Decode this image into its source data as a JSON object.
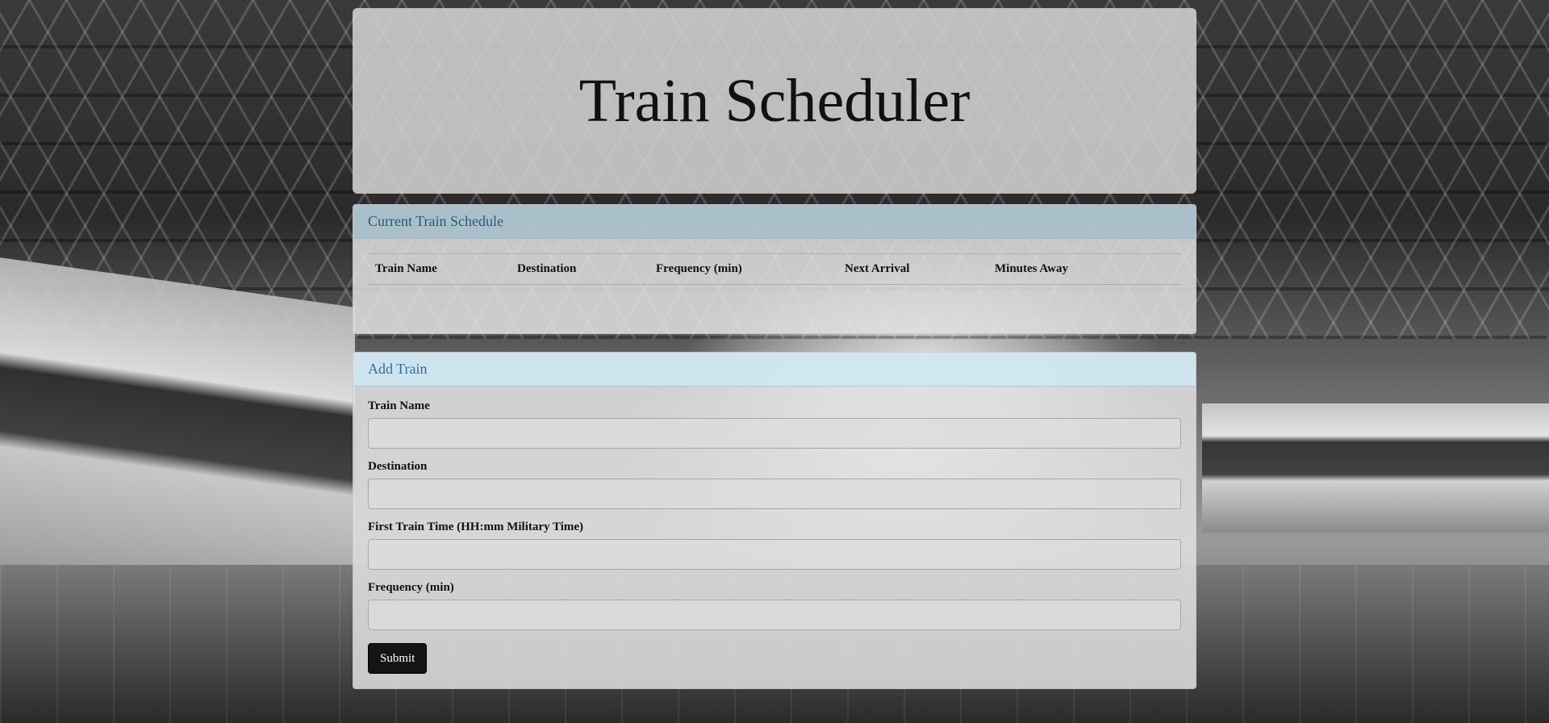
{
  "header": {
    "title": "Train Scheduler"
  },
  "schedule": {
    "heading": "Current Train Schedule",
    "columns": [
      "Train Name",
      "Destination",
      "Frequency (min)",
      "Next Arrival",
      "Minutes Away"
    ],
    "rows": []
  },
  "add_train": {
    "heading": "Add Train",
    "fields": [
      {
        "label": "Train Name",
        "value": "",
        "placeholder": ""
      },
      {
        "label": "Destination",
        "value": "",
        "placeholder": ""
      },
      {
        "label": "First Train Time (HH:mm Military Time)",
        "value": "",
        "placeholder": ""
      },
      {
        "label": "Frequency (min)",
        "value": "",
        "placeholder": ""
      }
    ],
    "submit_label": "Submit"
  },
  "colors": {
    "primary_heading_bg": "#a2becc",
    "info_heading_bg": "#cde8f5",
    "submit_bg": "#141414"
  }
}
